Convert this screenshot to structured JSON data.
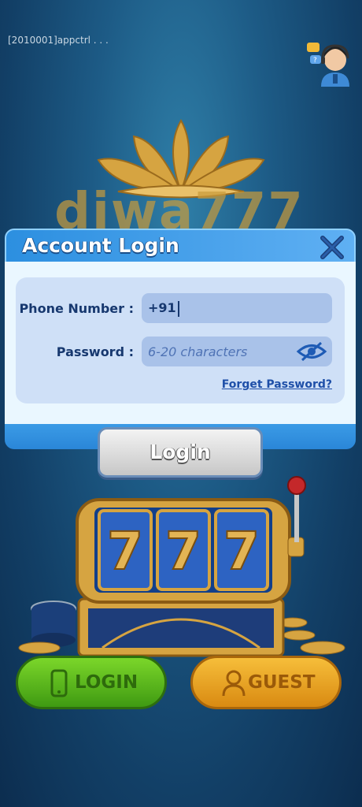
{
  "status": {
    "text": "[2010001]appctrl  . . ."
  },
  "brand": {
    "logo_text": "diwa777"
  },
  "dialog": {
    "title": "Account Login",
    "phone": {
      "label": "Phone Number :",
      "value": "+91"
    },
    "password": {
      "label": "Password :",
      "placeholder": "6-20 characters"
    },
    "forget_password": "Forget Password?",
    "login_button": "Login"
  },
  "bottom": {
    "login_label": "LOGIN",
    "guest_label": "GUEST"
  },
  "slot": {
    "reels": [
      "7",
      "7",
      "7"
    ]
  },
  "colors": {
    "header": "#2c8fe0",
    "panel": "#cfe0f7",
    "field": "#a9c2e9",
    "text_dark": "#17386f",
    "login_green": "#4fae1a",
    "guest_orange": "#e79a1c"
  },
  "icons": [
    "support-agent-icon",
    "close-icon",
    "eye-slash-icon",
    "phone-icon",
    "person-icon"
  ]
}
